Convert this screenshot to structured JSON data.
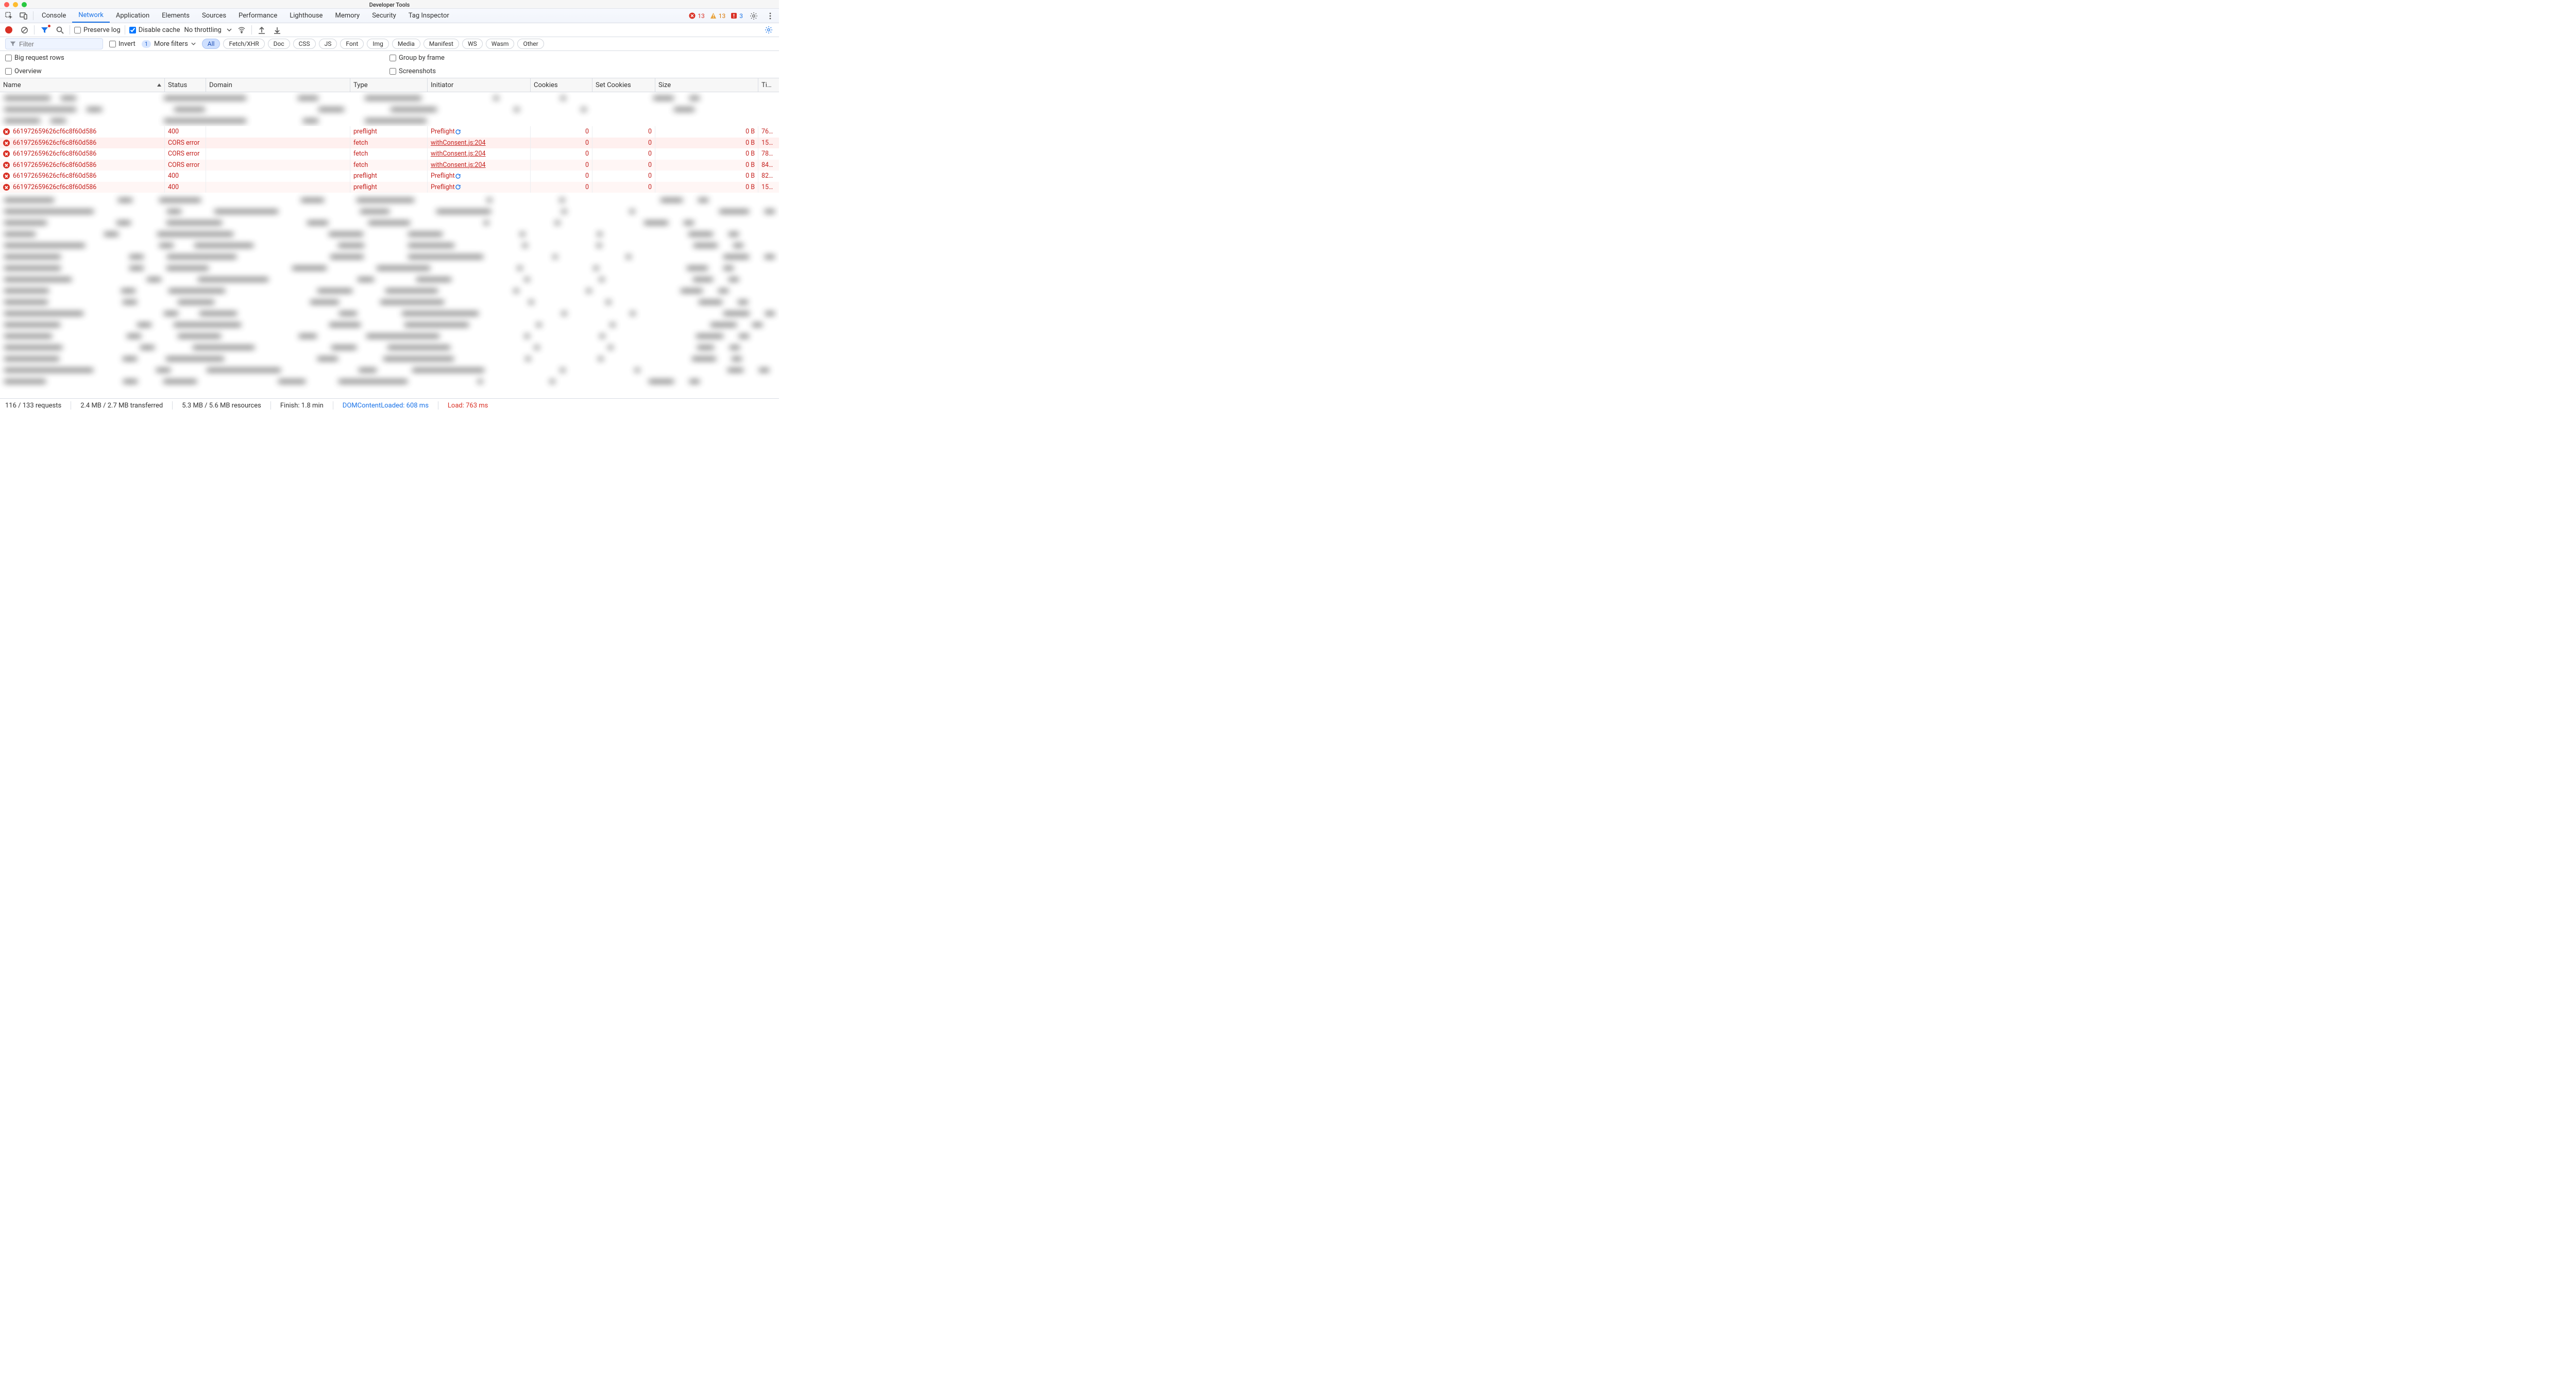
{
  "title": "Developer Tools",
  "tabs": [
    "Console",
    "Network",
    "Application",
    "Elements",
    "Sources",
    "Performance",
    "Lighthouse",
    "Memory",
    "Security",
    "Tag Inspector"
  ],
  "activeTab": "Network",
  "counts": {
    "errors": "13",
    "warnings": "13",
    "issues": "3"
  },
  "recordbar": {
    "preserve_log": "Preserve log",
    "disable_cache": "Disable cache",
    "throttling": "No throttling"
  },
  "filterrow": {
    "placeholder": "Filter",
    "invert": "Invert",
    "more_filters_count": "1",
    "more_filters": "More filters",
    "chips": [
      "All",
      "Fetch/XHR",
      "Doc",
      "CSS",
      "JS",
      "Font",
      "Img",
      "Media",
      "Manifest",
      "WS",
      "Wasm",
      "Other"
    ]
  },
  "options": {
    "big_request_rows": "Big request rows",
    "group_by_frame": "Group by frame",
    "overview": "Overview",
    "screenshots": "Screenshots"
  },
  "columns": {
    "name": "Name",
    "status": "Status",
    "domain": "Domain",
    "type": "Type",
    "initiator": "Initiator",
    "cookies": "Cookies",
    "set_cookies": "Set Cookies",
    "size": "Size",
    "time": "Ti…"
  },
  "rows": [
    {
      "name": "661972659626cf6c8f60d586",
      "status": "400",
      "type": "preflight",
      "initiator": "Preflight",
      "initiator_icon": true,
      "cookies": "0",
      "set_cookies": "0",
      "size": "0 B",
      "time": "76…",
      "bg": ""
    },
    {
      "name": "661972659626cf6c8f60d586",
      "status": "CORS error",
      "type": "fetch",
      "initiator": "withConsent.js:204",
      "initiator_link": true,
      "cookies": "0",
      "set_cookies": "0",
      "size": "0 B",
      "time": "15…",
      "bg": "pinkbg"
    },
    {
      "name": "661972659626cf6c8f60d586",
      "status": "CORS error",
      "type": "fetch",
      "initiator": "withConsent.js:204",
      "initiator_link": true,
      "cookies": "0",
      "set_cookies": "0",
      "size": "0 B",
      "time": "78…",
      "bg": ""
    },
    {
      "name": "661972659626cf6c8f60d586",
      "status": "CORS error",
      "type": "fetch",
      "initiator": "withConsent.js:204",
      "initiator_link": true,
      "cookies": "0",
      "set_cookies": "0",
      "size": "0 B",
      "time": "84…",
      "bg": "pinkbg2"
    },
    {
      "name": "661972659626cf6c8f60d586",
      "status": "400",
      "type": "preflight",
      "initiator": "Preflight",
      "initiator_icon": true,
      "cookies": "0",
      "set_cookies": "0",
      "size": "0 B",
      "time": "82…",
      "bg": ""
    },
    {
      "name": "661972659626cf6c8f60d586",
      "status": "400",
      "type": "preflight",
      "initiator": "Preflight",
      "initiator_icon": true,
      "cookies": "0",
      "set_cookies": "0",
      "size": "0 B",
      "time": "15…",
      "bg": "pinkbg2"
    }
  ],
  "status": {
    "requests": "116 / 133 requests",
    "transferred": "2.4 MB / 2.7 MB transferred",
    "resources": "5.3 MB / 5.6 MB resources",
    "finish": "Finish: 1.8 min",
    "dcl": "DOMContentLoaded: 608 ms",
    "load": "Load: 763 ms"
  }
}
